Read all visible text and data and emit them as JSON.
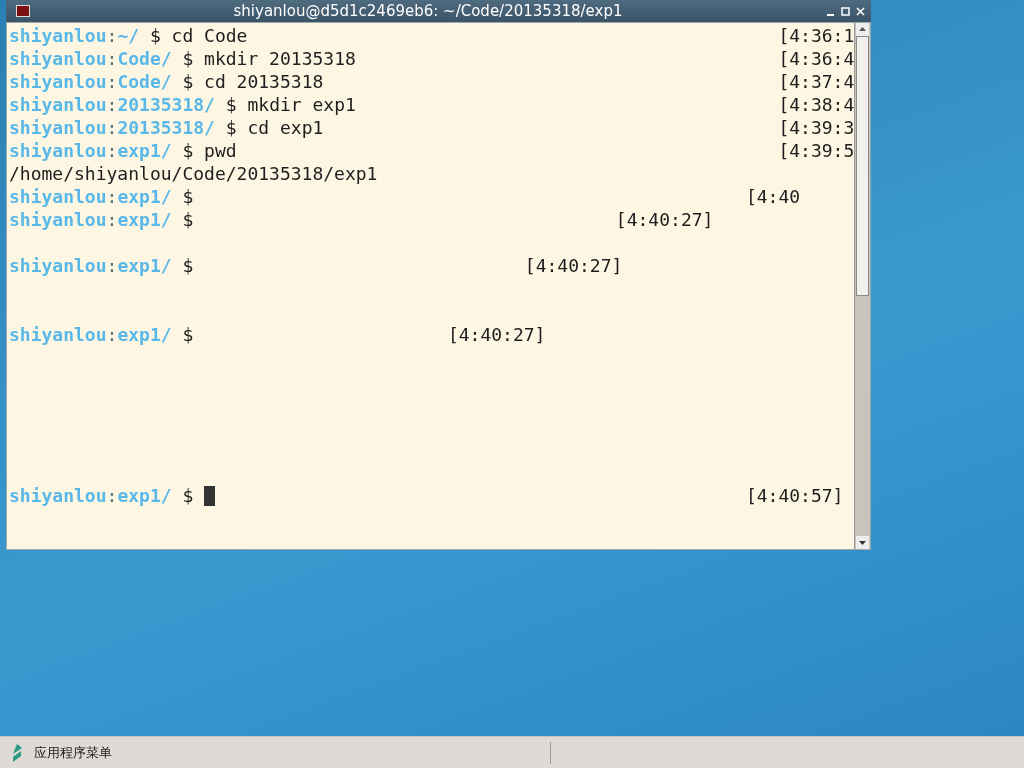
{
  "window": {
    "title": "shiyanlou@d5d1c2469eb6: ~/Code/20135318/exp1"
  },
  "terminal": {
    "lines": [
      {
        "kind": "prompt",
        "user": "shiyanlou",
        "separator": ":",
        "dir": "~/",
        "symbol": "$",
        "command": "cd Code",
        "time": "[4:36:1"
      },
      {
        "kind": "prompt",
        "user": "shiyanlou",
        "separator": ":",
        "dir": "Code/",
        "symbol": "$",
        "command": "mkdir 20135318",
        "time": "[4:36:4"
      },
      {
        "kind": "prompt",
        "user": "shiyanlou",
        "separator": ":",
        "dir": "Code/",
        "symbol": "$",
        "command": "cd 20135318",
        "time": "[4:37:4"
      },
      {
        "kind": "prompt",
        "user": "shiyanlou",
        "separator": ":",
        "dir": "20135318/",
        "symbol": "$",
        "command": "mkdir exp1",
        "time": "[4:38:4"
      },
      {
        "kind": "prompt",
        "user": "shiyanlou",
        "separator": ":",
        "dir": "20135318/",
        "symbol": "$",
        "command": "cd exp1",
        "time": "[4:39:3"
      },
      {
        "kind": "prompt",
        "user": "shiyanlou",
        "separator": ":",
        "dir": "exp1/",
        "symbol": "$",
        "command": "pwd",
        "time": "[4:39:5"
      },
      {
        "kind": "output",
        "text": "/home/shiyanlou/Code/20135318/exp1"
      },
      {
        "kind": "prompt",
        "user": "shiyanlou",
        "separator": ":",
        "dir": "exp1/",
        "symbol": "$",
        "time": "[4:40"
      },
      {
        "kind": "prompt",
        "user": "shiyanlou",
        "separator": ":",
        "dir": "exp1/",
        "symbol": "$",
        "time": "[4:40:27]"
      },
      {
        "kind": "blank"
      },
      {
        "kind": "prompt",
        "user": "shiyanlou",
        "separator": ":",
        "dir": "exp1/",
        "symbol": "$",
        "time": "[4:40:27]"
      },
      {
        "kind": "blank"
      },
      {
        "kind": "blank"
      },
      {
        "kind": "prompt",
        "user": "shiyanlou",
        "separator": ":",
        "dir": "exp1/",
        "symbol": "$",
        "time": "[4:40:27]"
      },
      {
        "kind": "blank"
      },
      {
        "kind": "blank"
      },
      {
        "kind": "blank"
      },
      {
        "kind": "blank"
      },
      {
        "kind": "blank"
      },
      {
        "kind": "blank"
      },
      {
        "kind": "prompt",
        "user": "shiyanlou",
        "separator": ":",
        "dir": "exp1/",
        "symbol": "$",
        "time": "[4:40:57]",
        "cursor": true
      }
    ]
  },
  "taskbar": {
    "menu_label": "应用程序菜单"
  }
}
